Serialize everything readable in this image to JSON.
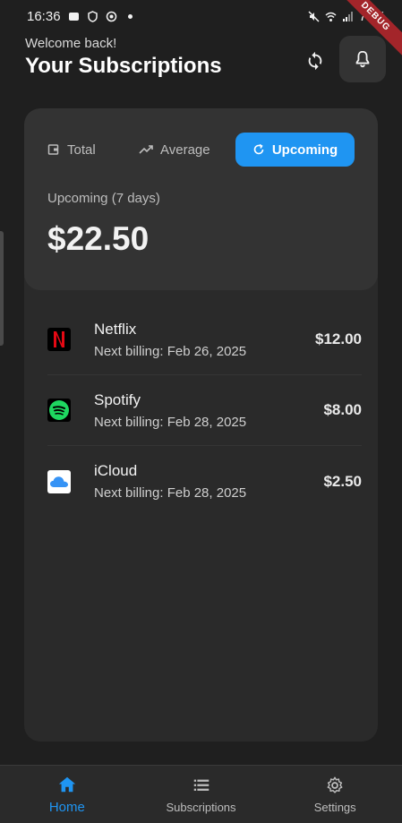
{
  "status_bar": {
    "time": "16:36",
    "battery": "71%",
    "debug_label": "DEBUG"
  },
  "header": {
    "welcome": "Welcome back!",
    "title": "Your Subscriptions"
  },
  "summary": {
    "tabs": [
      {
        "label": "Total",
        "icon": "wallet-icon",
        "selected": false
      },
      {
        "label": "Average",
        "icon": "trending-up-icon",
        "selected": false
      },
      {
        "label": "Upcoming",
        "icon": "refresh-circle-icon",
        "selected": true
      }
    ],
    "label": "Upcoming (7 days)",
    "amount": "$22.50"
  },
  "subscriptions": [
    {
      "name": "Netflix",
      "next_billing": "Next billing: Feb 26, 2025",
      "price": "$12.00",
      "logo": "netflix-logo"
    },
    {
      "name": "Spotify",
      "next_billing": "Next billing: Feb 28, 2025",
      "price": "$8.00",
      "logo": "spotify-logo"
    },
    {
      "name": "iCloud",
      "next_billing": "Next billing: Feb 28, 2025",
      "price": "$2.50",
      "logo": "icloud-logo"
    }
  ],
  "bottom_nav": [
    {
      "label": "Home",
      "icon": "home-icon",
      "active": true
    },
    {
      "label": "Subscriptions",
      "icon": "list-icon",
      "active": false
    },
    {
      "label": "Settings",
      "icon": "gear-icon",
      "active": false
    }
  ],
  "colors": {
    "accent": "#1f95f2",
    "background": "#1f1f1f",
    "card": "#2a2a2a",
    "summary": "#333333"
  }
}
